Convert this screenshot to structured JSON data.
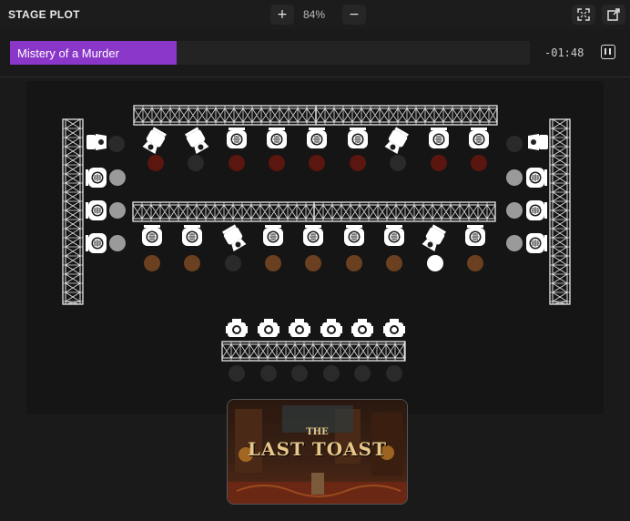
{
  "header": {
    "title": "STAGE PLOT",
    "zoom_in_label": "+",
    "zoom_level": "84%",
    "zoom_out_label": "−"
  },
  "cue": {
    "name": "Mistery of a Murder",
    "progress": 0.32,
    "time_remaining": "-01:48",
    "color": "#8a36c9"
  },
  "poster": {
    "line1": "THE",
    "line2": "LAST TOAST"
  },
  "colors": {
    "white": "#ffffff",
    "grey": "#9a9a9a",
    "dark": "#2a2a2a",
    "red": "#5a160f",
    "amber": "#6b4020"
  },
  "rig": {
    "upper_truss": [
      {
        "type": "wash",
        "color": "dark"
      },
      {
        "type": "spot",
        "color": "red"
      },
      {
        "type": "spot",
        "color": "dark"
      },
      {
        "type": "wash",
        "color": "red"
      },
      {
        "type": "wash",
        "color": "red"
      },
      {
        "type": "wash",
        "color": "red"
      },
      {
        "type": "wash",
        "color": "red"
      },
      {
        "type": "spot",
        "color": "dark"
      },
      {
        "type": "wash",
        "color": "red"
      },
      {
        "type": "wash",
        "color": "red"
      }
    ],
    "middle_truss": [
      {
        "type": "wash",
        "color": "amber"
      },
      {
        "type": "wash",
        "color": "amber"
      },
      {
        "type": "spot",
        "color": "dark"
      },
      {
        "type": "wash",
        "color": "amber"
      },
      {
        "type": "wash",
        "color": "amber"
      },
      {
        "type": "wash",
        "color": "amber"
      },
      {
        "type": "wash",
        "color": "amber"
      },
      {
        "type": "spot",
        "color": "white"
      },
      {
        "type": "wash",
        "color": "amber"
      }
    ],
    "left_tower": [
      {
        "type": "par",
        "color": "dark"
      },
      {
        "type": "wash",
        "color": "grey"
      },
      {
        "type": "wash",
        "color": "grey"
      },
      {
        "type": "wash",
        "color": "grey"
      }
    ],
    "right_tower": [
      {
        "type": "par",
        "color": "dark"
      },
      {
        "type": "wash",
        "color": "grey"
      },
      {
        "type": "wash",
        "color": "grey"
      },
      {
        "type": "wash",
        "color": "grey"
      }
    ],
    "front_truss": [
      {
        "type": "profile",
        "color": "dark"
      },
      {
        "type": "profile",
        "color": "dark"
      },
      {
        "type": "profile",
        "color": "dark"
      },
      {
        "type": "profile",
        "color": "dark"
      },
      {
        "type": "profile",
        "color": "dark"
      },
      {
        "type": "profile",
        "color": "dark"
      }
    ]
  }
}
